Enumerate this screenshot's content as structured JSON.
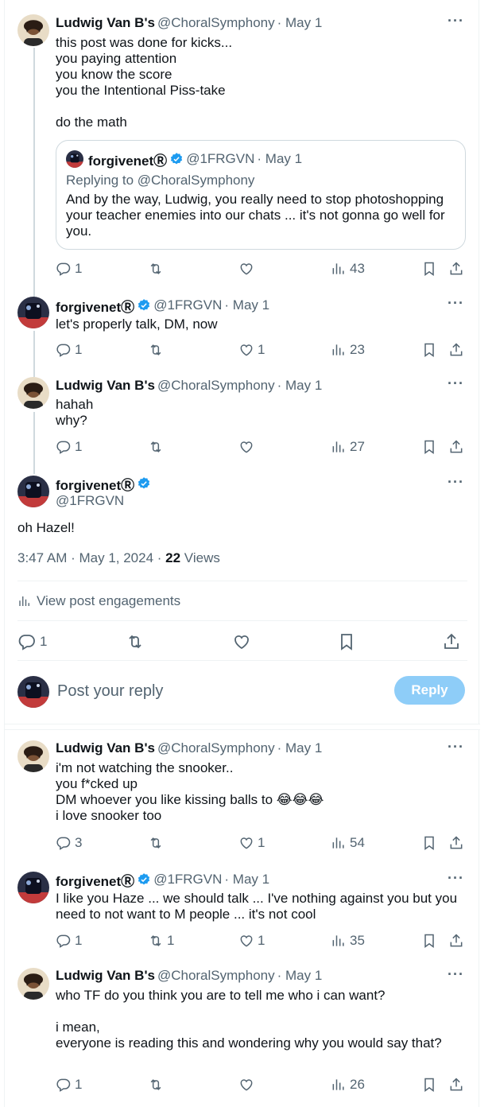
{
  "tweets": [
    {
      "name": "Ludwig Van B's",
      "handle": "@ChoralSymphony",
      "date": "· May 1",
      "text": "this post was done for kicks...\nyou paying attention\nyou know the score\nyou the Intentional Piss-take\n\ndo the math",
      "quote": {
        "name": "forgivenetⓇ",
        "handle": "@1FRGVN",
        "date": "· May 1",
        "replying": "Replying to @ChoralSymphony",
        "text": "And by the way, Ludwig, you really need to stop photoshopping your teacher enemies into our chats ... it's not gonna go well for you."
      },
      "replies": "1",
      "retweets": "",
      "likes": "",
      "views": "43"
    },
    {
      "name": "forgivenetⓇ",
      "handle": "@1FRGVN",
      "date": "· May 1",
      "text": "let's properly talk, DM, now",
      "replies": "1",
      "retweets": "",
      "likes": "1",
      "views": "23"
    },
    {
      "name": "Ludwig Van B's",
      "handle": "@ChoralSymphony",
      "date": "· May 1",
      "text": "hahah\nwhy?",
      "replies": "1",
      "retweets": "",
      "likes": "",
      "views": "27"
    }
  ],
  "main_post": {
    "name": "forgivenetⓇ",
    "handle": "@1FRGVN",
    "text": "oh Hazel!",
    "timestamp": "3:47 AM · May 1, 2024 · ",
    "views_count": "22",
    "views_label": " Views",
    "engagements": "View post engagements",
    "replies": "1"
  },
  "composer": {
    "placeholder": "Post your reply",
    "reply_button": "Reply"
  },
  "replies": [
    {
      "name": "Ludwig Van B's",
      "handle": "@ChoralSymphony",
      "date": "· May 1",
      "text": "i'm not watching the snooker..\nyou f*cked up\nDM whoever you like kissing balls to 😂😂😂\ni love snooker too",
      "replies": "3",
      "retweets": "",
      "likes": "1",
      "views": "54"
    },
    {
      "name": "forgivenetⓇ",
      "handle": "@1FRGVN",
      "date": "· May 1",
      "text": "I like you Haze ... we should talk ... I've nothing against you but you need to not want to M people ... it's not cool",
      "replies": "1",
      "retweets": "1",
      "likes": "1",
      "views": "35"
    },
    {
      "name": "Ludwig Van B's",
      "handle": "@ChoralSymphony",
      "date": "· May 1",
      "text": "who TF do you think you are to tell me who i can want?\n\ni mean,\neveryone is reading this and wondering why you would say that?",
      "replies": "1",
      "retweets": "",
      "likes": "",
      "views": "26"
    }
  ],
  "icons": [
    "more-icon",
    "reply-icon",
    "retweet-icon",
    "like-icon",
    "views-icon",
    "bookmark-icon",
    "share-icon",
    "verified-icon"
  ],
  "colors": {
    "verified": "#1d9bf0",
    "reply_button": "#8ecdf8",
    "muted": "#536471"
  }
}
